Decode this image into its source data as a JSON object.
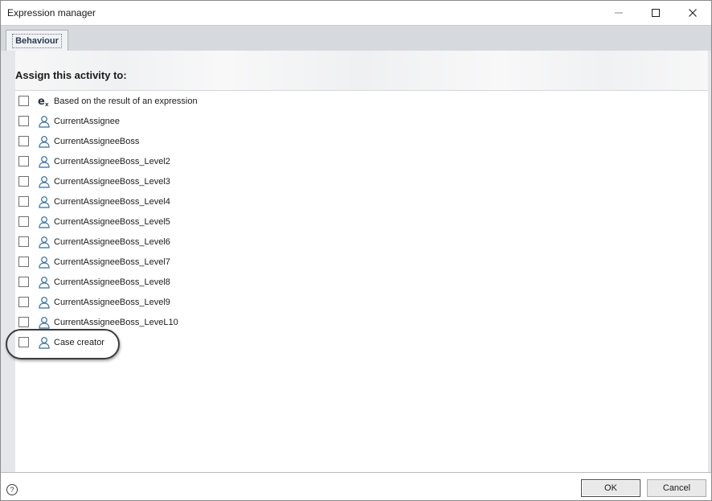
{
  "window": {
    "title": "Expression manager"
  },
  "tabs": [
    {
      "label": "Behaviour",
      "active": true
    }
  ],
  "main": {
    "heading": "Assign this activity to:",
    "items": [
      {
        "label": "Based on the result of an expression",
        "icon": "expression-icon",
        "checked": false
      },
      {
        "label": "CurrentAssignee",
        "icon": "user-icon",
        "checked": false
      },
      {
        "label": "CurrentAssigneeBoss",
        "icon": "user-icon",
        "checked": false
      },
      {
        "label": "CurrentAssigneeBoss_Level2",
        "icon": "user-icon",
        "checked": false
      },
      {
        "label": "CurrentAssigneeBoss_Level3",
        "icon": "user-icon",
        "checked": false
      },
      {
        "label": "CurrentAssigneeBoss_Level4",
        "icon": "user-icon",
        "checked": false
      },
      {
        "label": "CurrentAssigneeBoss_Level5",
        "icon": "user-icon",
        "checked": false
      },
      {
        "label": "CurrentAssigneeBoss_Level6",
        "icon": "user-icon",
        "checked": false
      },
      {
        "label": "CurrentAssigneeBoss_Level7",
        "icon": "user-icon",
        "checked": false
      },
      {
        "label": "CurrentAssigneeBoss_Level8",
        "icon": "user-icon",
        "checked": false
      },
      {
        "label": "CurrentAssigneeBoss_Level9",
        "icon": "user-icon",
        "checked": false
      },
      {
        "label": "CurrentAssigneeBoss_LeveL10",
        "icon": "user-icon",
        "checked": false
      },
      {
        "label": "Case creator",
        "icon": "user-icon",
        "checked": false
      }
    ]
  },
  "footer": {
    "help_glyph": "?",
    "ok_label": "OK",
    "cancel_label": "Cancel"
  },
  "colors": {
    "accent_icon": "#2f6ea5",
    "tabstrip": "#d6d9de"
  }
}
